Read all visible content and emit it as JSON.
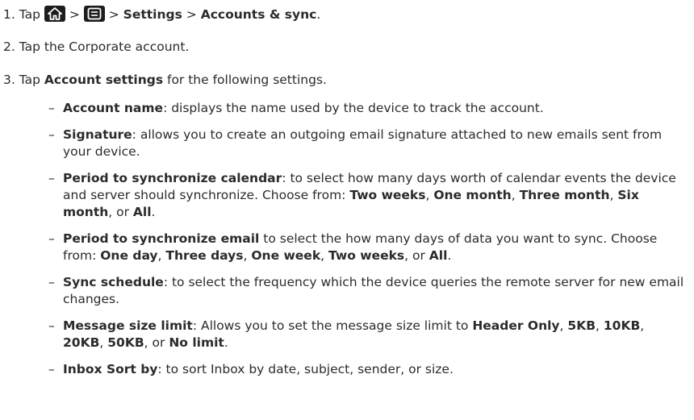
{
  "steps": [
    {
      "num": "1.",
      "tap": "Tap",
      "sep": ">",
      "settings": "Settings",
      "accounts": "Accounts & sync",
      "end": "."
    },
    {
      "num": "2.",
      "text": "Tap the Corporate account."
    },
    {
      "num": "3.",
      "tap": "Tap",
      "bold": "Account settings",
      "rest": "for the following settings."
    }
  ],
  "icons": [
    "home-icon",
    "menu-icon"
  ],
  "bullets": [
    {
      "parts": [
        {
          "t": "Account name",
          "b": true
        },
        {
          "t": ": displays the name used by the device to track the account.",
          "b": false
        }
      ]
    },
    {
      "parts": [
        {
          "t": "Signature",
          "b": true
        },
        {
          "t": ": allows you to create an outgoing email signature attached to new emails sent from your device.",
          "b": false
        }
      ]
    },
    {
      "parts": [
        {
          "t": "Period to synchronize calendar",
          "b": true
        },
        {
          "t": ": to select how many days worth of calendar events the device and server should synchronize. Choose from: ",
          "b": false
        },
        {
          "t": "Two weeks",
          "b": true
        },
        {
          "t": ", ",
          "b": false
        },
        {
          "t": "One month",
          "b": true
        },
        {
          "t": ", ",
          "b": false
        },
        {
          "t": "Three month",
          "b": true
        },
        {
          "t": ", ",
          "b": false
        },
        {
          "t": "Six month",
          "b": true
        },
        {
          "t": ", or ",
          "b": false
        },
        {
          "t": "All",
          "b": true
        },
        {
          "t": ".",
          "b": false
        }
      ]
    },
    {
      "parts": [
        {
          "t": "Period to synchronize email",
          "b": true
        },
        {
          "t": " to select the how many days of data you want to sync. Choose from: ",
          "b": false
        },
        {
          "t": "One day",
          "b": true
        },
        {
          "t": ", ",
          "b": false
        },
        {
          "t": "Three days",
          "b": true
        },
        {
          "t": ", ",
          "b": false
        },
        {
          "t": "One week",
          "b": true
        },
        {
          "t": ", ",
          "b": false
        },
        {
          "t": "Two weeks",
          "b": true
        },
        {
          "t": ", or ",
          "b": false
        },
        {
          "t": "All",
          "b": true
        },
        {
          "t": ".",
          "b": false
        }
      ]
    },
    {
      "parts": [
        {
          "t": "Sync schedule",
          "b": true
        },
        {
          "t": ": to select the frequency which the device queries the remote server for new email changes.",
          "b": false
        }
      ]
    },
    {
      "parts": [
        {
          "t": "Message size limit",
          "b": true
        },
        {
          "t": ": Allows you to set the message size limit to ",
          "b": false
        },
        {
          "t": "Header Only",
          "b": true
        },
        {
          "t": ", ",
          "b": false
        },
        {
          "t": "5KB",
          "b": true
        },
        {
          "t": ", ",
          "b": false
        },
        {
          "t": "10KB",
          "b": true
        },
        {
          "t": ", ",
          "b": false
        },
        {
          "t": "20KB",
          "b": true
        },
        {
          "t": ", ",
          "b": false
        },
        {
          "t": "50KB",
          "b": true
        },
        {
          "t": ", or ",
          "b": false
        },
        {
          "t": "No limit",
          "b": true
        },
        {
          "t": ".",
          "b": false
        }
      ]
    },
    {
      "parts": [
        {
          "t": "Inbox Sort by",
          "b": true
        },
        {
          "t": ": to sort Inbox by date, subject, sender, or size.",
          "b": false
        }
      ]
    }
  ],
  "bullet_dash": "–"
}
